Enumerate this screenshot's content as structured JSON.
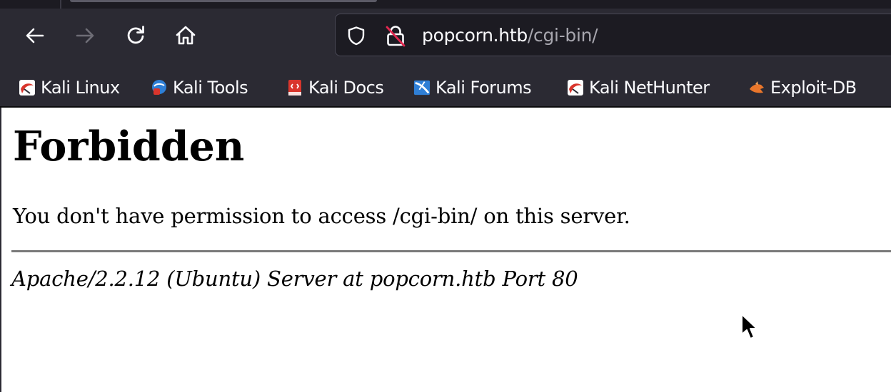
{
  "browser": {
    "url_host": "popcorn.htb",
    "url_path": "/cgi-bin/",
    "toolbar": {
      "back_icon": "back-arrow-icon",
      "forward_icon": "forward-arrow-icon",
      "reload_icon": "reload-icon",
      "home_icon": "home-icon",
      "tracking_protection_icon": "shield-icon",
      "insecure_lock_icon": "insecure-lock-icon"
    },
    "bookmarks": [
      {
        "label": "Kali Linux",
        "icon": "kali-dragon-icon"
      },
      {
        "label": "Kali Tools",
        "icon": "kali-tools-icon"
      },
      {
        "label": "Kali Docs",
        "icon": "kali-docs-icon"
      },
      {
        "label": "Kali Forums",
        "icon": "kali-forums-icon"
      },
      {
        "label": "Kali NetHunter",
        "icon": "kali-nethunter-icon"
      },
      {
        "label": "Exploit-DB",
        "icon": "exploit-db-icon"
      }
    ]
  },
  "page": {
    "heading": "Forbidden",
    "message": "You don't have permission to access /cgi-bin/ on this server.",
    "signature": "Apache/2.2.12 (Ubuntu) Server at popcorn.htb Port 80"
  },
  "colors": {
    "chrome_bg": "#2b2a33",
    "urlbar_bg": "#1c1b22",
    "chrome_text": "#fbfbfe",
    "url_path_text": "#a7a6ae",
    "kali_red": "#d9352c",
    "kali_blue": "#2f7fd6",
    "exploitdb_orange": "#e9762b"
  }
}
